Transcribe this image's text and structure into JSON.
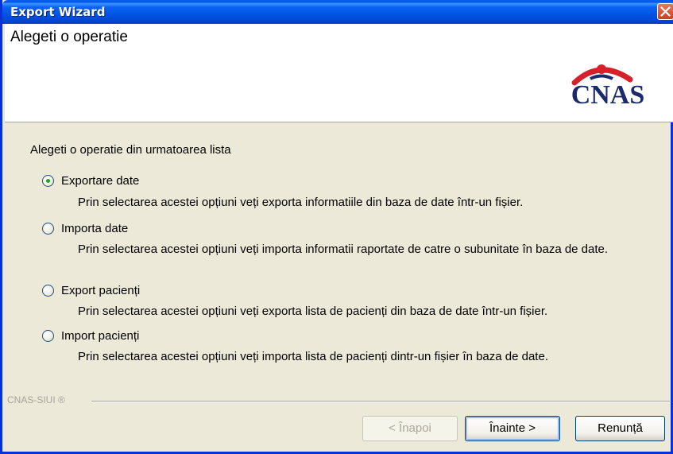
{
  "window": {
    "title": "Export Wizard"
  },
  "header": {
    "title": "Alegeti o operatie",
    "logo_text": "CNAS"
  },
  "content": {
    "intro": "Alegeti o operatie din urmatoarea lista",
    "options": [
      {
        "label": "Exportare date",
        "selected": true,
        "description": "Prin selectarea acestei opțiuni veți exporta informatiile din baza de date într-un fișier."
      },
      {
        "label": "Importa date",
        "selected": false,
        "description": "Prin selectarea acestei opțiuni veți importa informatii raportate de catre o subunitate în baza de date."
      },
      {
        "label": "Export pacienți",
        "selected": false,
        "description": "Prin selectarea acestei opțiuni veți exporta lista de pacienți din baza de date într-un fișier."
      },
      {
        "label": "Import pacienți",
        "selected": false,
        "description": "Prin selectarea acestei opțiuni veți importa lista de pacienți dintr-un fișier în baza de date."
      }
    ]
  },
  "footer": {
    "brand": "CNAS-SIUI ®",
    "back_label": "< Înapoi",
    "next_label": "Înainte >",
    "cancel_label": "Renunță"
  },
  "colors": {
    "titlebar": "#0054e3",
    "window_bg": "#ece9d8",
    "logo_red": "#d7212a",
    "logo_blue": "#1b2a6b",
    "radio_selected": "#21a121"
  }
}
